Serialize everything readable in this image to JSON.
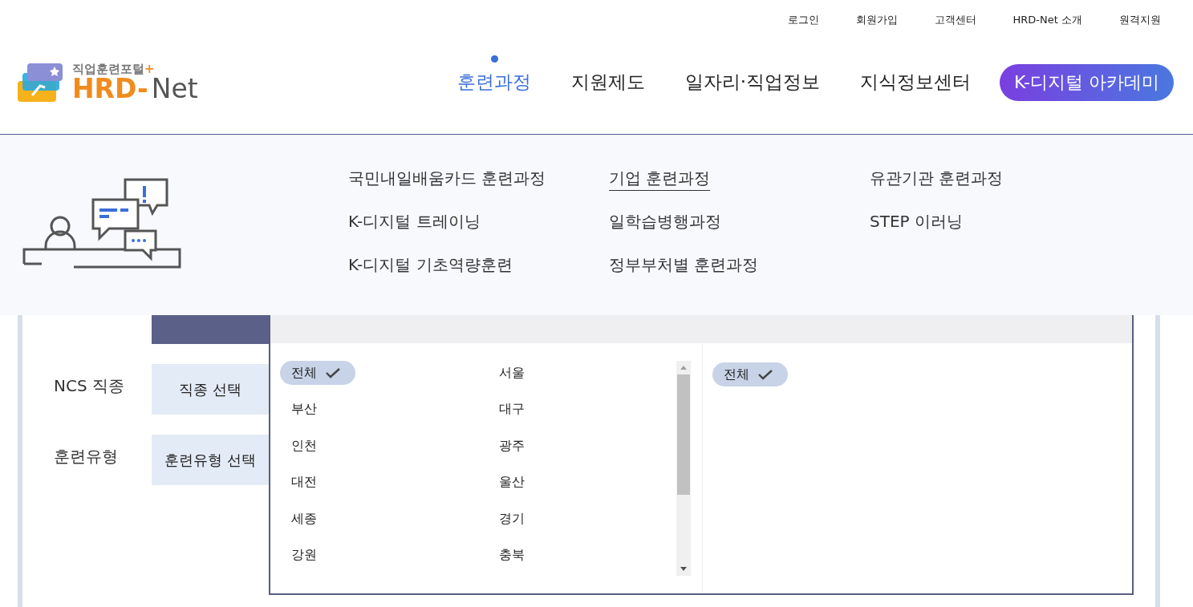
{
  "utility_links": [
    "로그인",
    "회원가입",
    "고객센터",
    "HRD-Net 소개",
    "원격지원"
  ],
  "logo": {
    "tagline": "직업훈련포털",
    "mark": "+",
    "name_primary": "HRD-",
    "name_secondary": "Net"
  },
  "nav": [
    {
      "label": "훈련과정",
      "selected": true,
      "kind": "link"
    },
    {
      "label": "지원제도",
      "selected": false,
      "kind": "link"
    },
    {
      "label": "일자리·직업정보",
      "selected": false,
      "kind": "link"
    },
    {
      "label": "지식정보센터",
      "selected": false,
      "kind": "link"
    },
    {
      "label": "K-디지털 아카데미",
      "selected": false,
      "kind": "pill"
    }
  ],
  "submenu": {
    "columns": [
      [
        {
          "label": "국민내일배움카드 훈련과정",
          "selected": false
        },
        {
          "label": "K-디지털 트레이닝",
          "selected": false
        },
        {
          "label": "K-디지털 기초역량훈련",
          "selected": false
        }
      ],
      [
        {
          "label": "기업 훈련과정",
          "selected": true
        },
        {
          "label": "일학습병행과정",
          "selected": false
        },
        {
          "label": "정부부처별 훈련과정",
          "selected": false
        }
      ],
      [
        {
          "label": "유관기관 훈련과정",
          "selected": false
        },
        {
          "label": "STEP 이러닝",
          "selected": false
        }
      ]
    ]
  },
  "filters": [
    {
      "selected": true
    },
    {
      "label": "NCS 직종",
      "button": "직종 선택",
      "selected": false
    },
    {
      "label": "훈련유형",
      "button": "훈련유형 선택",
      "selected": false
    }
  ],
  "picker": {
    "major_options": [
      {
        "label": "전체",
        "selected": true
      },
      {
        "label": "서울",
        "selected": false
      },
      {
        "label": "부산",
        "selected": false
      },
      {
        "label": "대구",
        "selected": false
      },
      {
        "label": "인천",
        "selected": false
      },
      {
        "label": "광주",
        "selected": false
      },
      {
        "label": "대전",
        "selected": false
      },
      {
        "label": "울산",
        "selected": false
      },
      {
        "label": "세종",
        "selected": false
      },
      {
        "label": "경기",
        "selected": false
      },
      {
        "label": "강원",
        "selected": false
      },
      {
        "label": "충북",
        "selected": false
      }
    ],
    "minor_options": [
      {
        "label": "전체",
        "selected": true
      }
    ]
  }
}
